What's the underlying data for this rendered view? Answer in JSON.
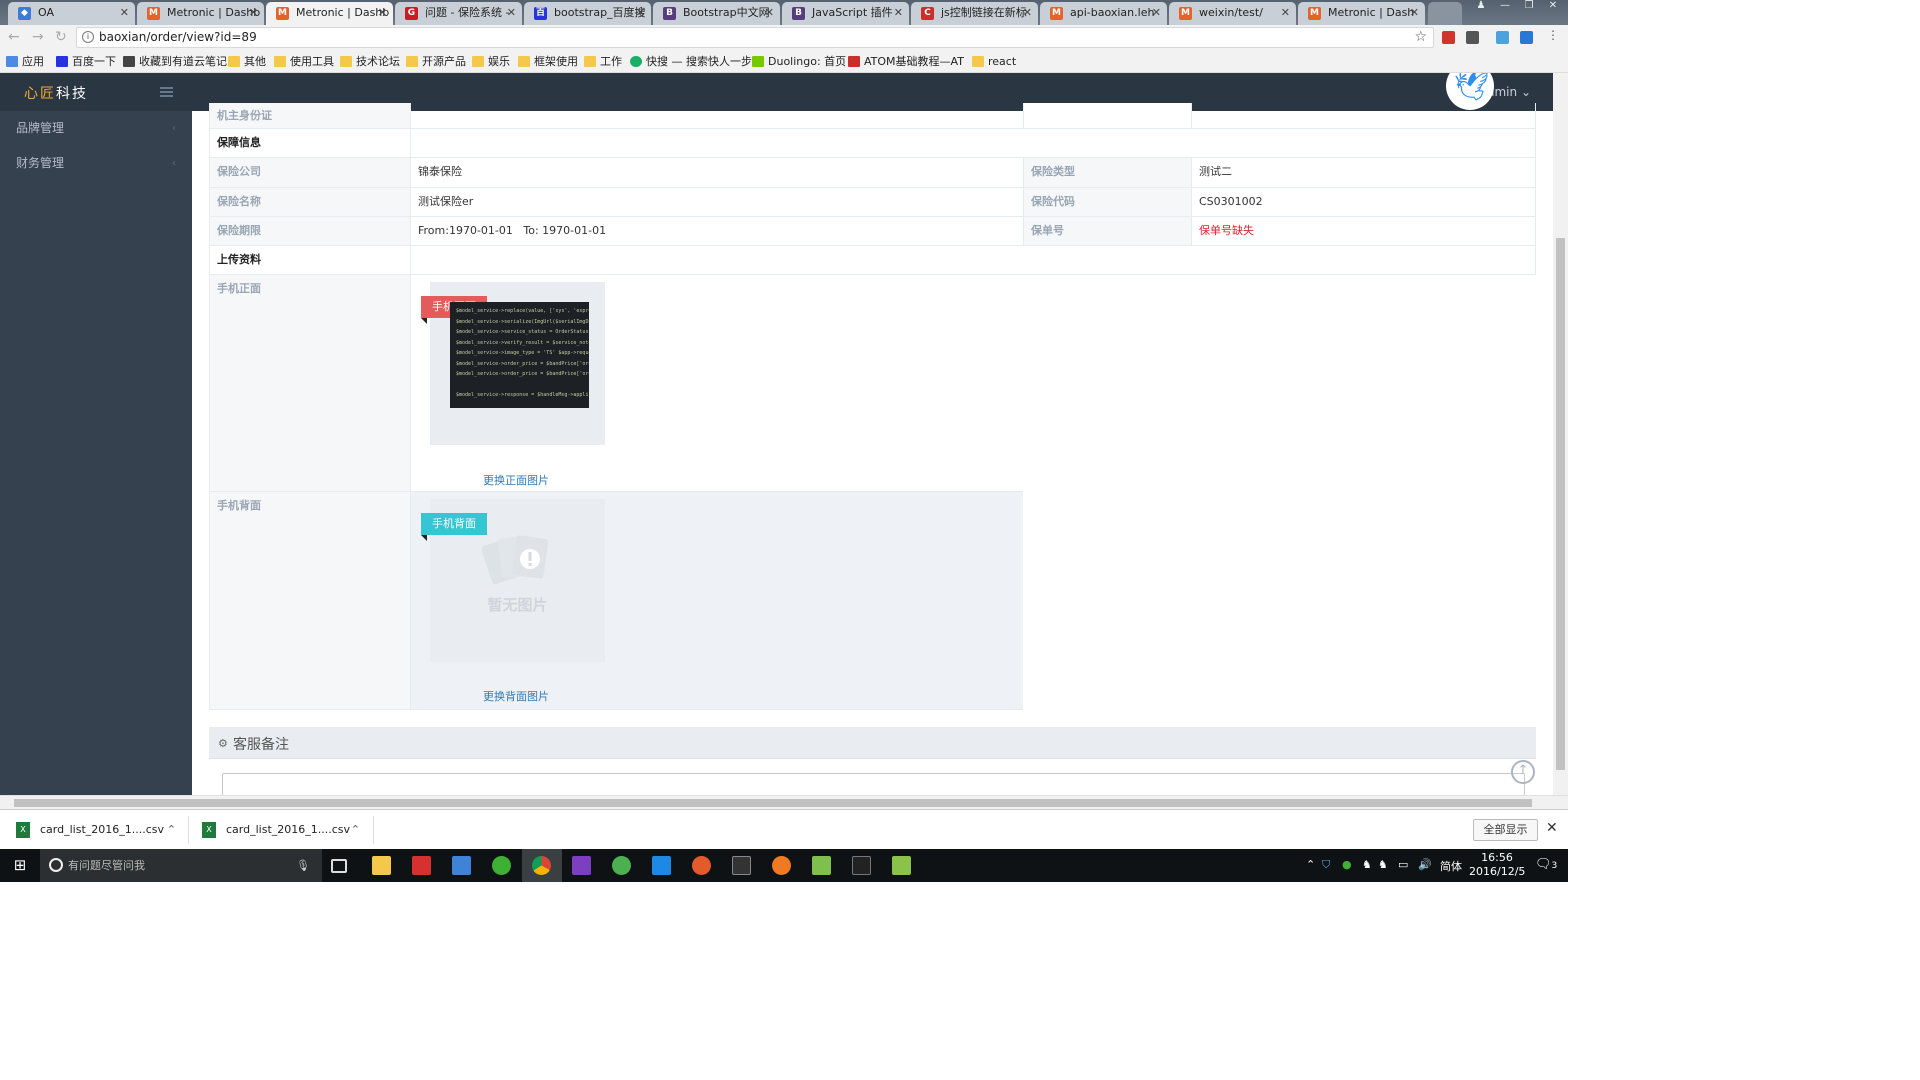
{
  "browser": {
    "tabs": [
      {
        "label": "OA",
        "icon": "oa-icon"
      },
      {
        "label": "Metronic | Dashb",
        "icon": "metronic-icon"
      },
      {
        "label": "Metronic | Dashb",
        "icon": "metronic-icon"
      },
      {
        "label": "问题 - 保险系统 -",
        "icon": "gitee-icon"
      },
      {
        "label": "bootstrap_百度搜",
        "icon": "baidu-icon"
      },
      {
        "label": "Bootstrap中文网",
        "icon": "bootstrap-icon"
      },
      {
        "label": "JavaScript 插件 ·",
        "icon": "bootstrap-icon"
      },
      {
        "label": "js控制链接在新标",
        "icon": "csdn-icon"
      },
      {
        "label": "api-baoxian.leh",
        "icon": "metronic-icon"
      },
      {
        "label": "weixin/test/",
        "icon": "metronic-icon"
      },
      {
        "label": "Metronic | Dash",
        "icon": "metronic-icon"
      }
    ],
    "url": "baoxian/order/view?id=89",
    "bookmarks": [
      "应用",
      "百度一下",
      "收藏到有道云笔记",
      "其他",
      "使用工具",
      "技术论坛",
      "开源产品",
      "娱乐",
      "框架使用",
      "工作",
      "快搜 — 搜索快人一步",
      "Duolingo: 首页",
      "ATOM基础教程—AT",
      "react"
    ]
  },
  "app": {
    "brand_accent": "心匠",
    "brand_rest": "科技",
    "user_label": "dmin",
    "sidebar": [
      {
        "label": "品牌管理"
      },
      {
        "label": "财务管理"
      }
    ]
  },
  "detail": {
    "top_partial_label": "机主身份证",
    "section_insurance": "保障信息",
    "rows": [
      {
        "l1": "保险公司",
        "v1": "锦泰保险",
        "l2": "保险类型",
        "v2": "测试二"
      },
      {
        "l1": "保险名称",
        "v1": "测试保险er",
        "l2": "保险代码",
        "v2": "CS0301002"
      },
      {
        "l1": "保险期限",
        "v1": "From:1970-01-01   To: 1970-01-01",
        "l2": "保单号",
        "v2": "保单号缺失"
      }
    ],
    "section_upload": "上传资料",
    "front": {
      "label": "手机正面",
      "ribbon": "手机正面",
      "change_link": "更换正面图片"
    },
    "back": {
      "label": "手机背面",
      "ribbon": "手机背面",
      "placeholder_text": "暂无图片",
      "change_link": "更换背面图片"
    }
  },
  "remarks": {
    "title": "客服备注"
  },
  "downloads": {
    "items": [
      "card_list_2016_1....csv",
      "card_list_2016_1....csv"
    ],
    "show_all": "全部显示"
  },
  "taskbar": {
    "search_placeholder": "有问题尽管问我",
    "ime": "简体",
    "time": "16:56",
    "date": "2016/12/5",
    "notification_count": "3"
  },
  "colors": {
    "header_bg": "#2b3643",
    "sidebar_bg": "#364150",
    "ribbon_front": "#e35b5a",
    "ribbon_back": "#36c6d3",
    "missing_text": "#e12330"
  }
}
